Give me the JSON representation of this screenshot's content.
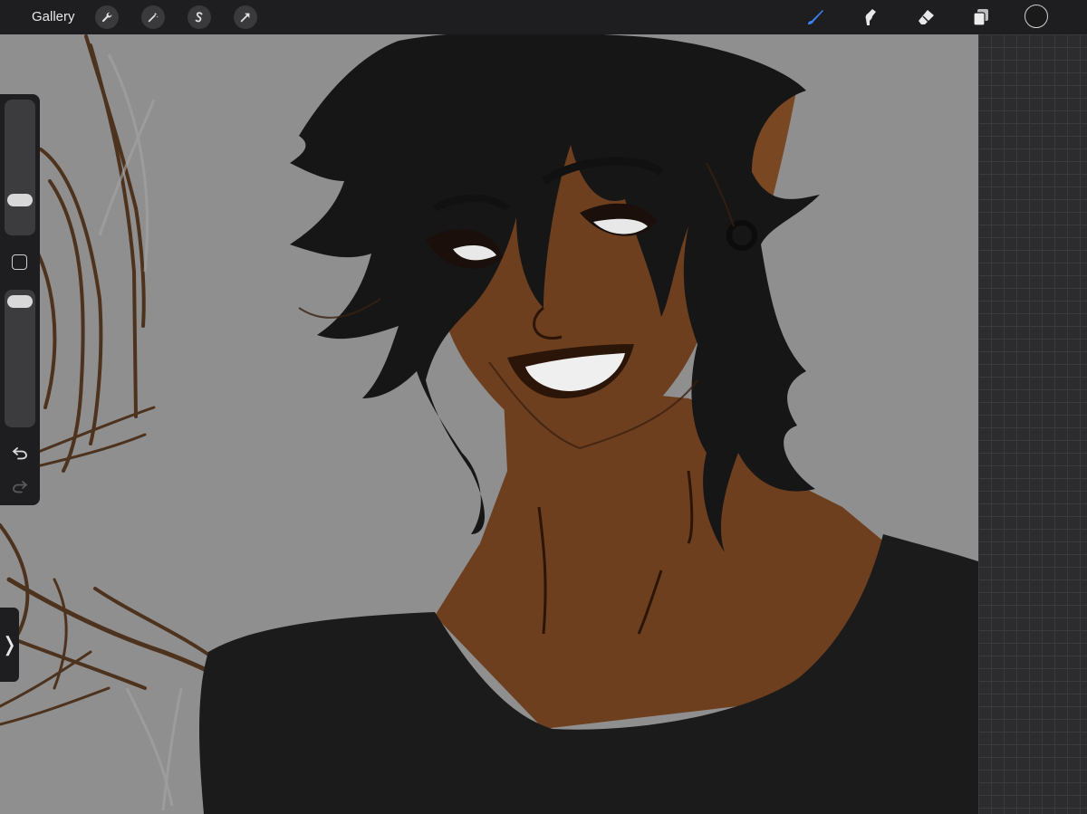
{
  "topbar": {
    "gallery_label": "Gallery",
    "action_icons": [
      "wrench-icon",
      "magic-wand-icon",
      "selection-icon",
      "transform-arrow-icon"
    ],
    "tools": [
      "brush-icon",
      "smudge-icon",
      "eraser-icon",
      "layers-icon"
    ],
    "active_tool": "brush",
    "active_color": "#1a1a1a",
    "accent_color": "#3b82f6"
  },
  "sidebar": {
    "brush_size_level": 0.5,
    "opacity_level": 0.95,
    "modify_button": "square-icon",
    "undo": "undo-icon",
    "redo": "redo-icon",
    "toggle_glyph": "❭"
  },
  "canvas": {
    "background_color": "#8f8f8f",
    "skin_color": "#6e3f1f",
    "hair_color": "#161616",
    "shirt_color": "#1b1b1b",
    "sketch_color": "#4a2e18"
  }
}
